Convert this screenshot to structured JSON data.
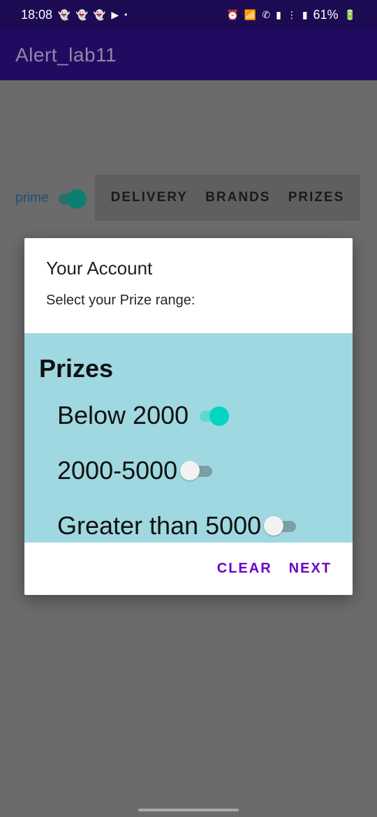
{
  "status_bar": {
    "time": "18:08",
    "left_icons": [
      "snapchat-icon",
      "snapchat-icon",
      "snapchat-icon",
      "youtube-icon"
    ],
    "dot": "•",
    "right_text": "61%",
    "right_icons": [
      "alarm-icon",
      "wifi-icon",
      "call-icon",
      "signal-icon",
      "volte-icon",
      "signal-icon",
      "battery-icon"
    ]
  },
  "app_bar": {
    "title": "Alert_lab11"
  },
  "main": {
    "prime_label": "prime",
    "prime_on": true,
    "tabs": [
      "DELIVERY",
      "BRANDS",
      "PRIZES"
    ]
  },
  "dialog": {
    "title": "Your Account",
    "message": "Select your Prize range:",
    "body_heading": "Prizes",
    "options": [
      {
        "label": "Below 2000",
        "checked": true
      },
      {
        "label": "2000-5000",
        "checked": false
      },
      {
        "label": "Greater than 5000",
        "checked": false
      }
    ],
    "actions": {
      "clear": "CLEAR",
      "next": "NEXT"
    }
  },
  "colors": {
    "status_bar": "#1c0a52",
    "app_bar": "#220a63",
    "accent_switch": "#00d6c3",
    "dialog_body": "#9fd8e0",
    "action_text": "#6a00c8",
    "scrim": "#6b6b6b"
  }
}
